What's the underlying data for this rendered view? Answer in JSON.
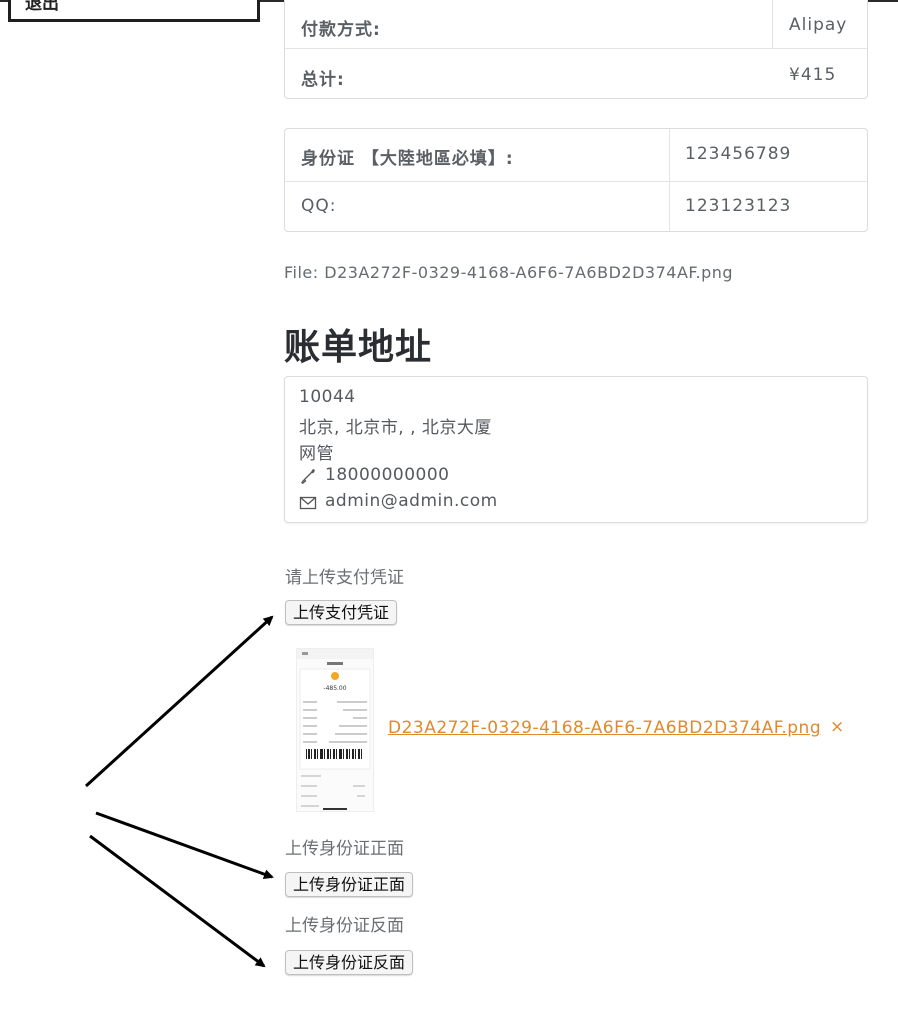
{
  "header": {
    "logout_label": "退出"
  },
  "order_summary": {
    "payment_method_label": "付款方式:",
    "payment_method_value": "Alipay",
    "total_label": "总计:",
    "total_value": "¥415"
  },
  "identity": {
    "id_card_label": "身份证 【大陸地區必填】:",
    "id_card_value": "123456789",
    "qq_label": "QQ:",
    "qq_value": "123123123"
  },
  "file_line": "File: D23A272F-0329-4168-A6F6-7A6BD2D374AF.png",
  "billing": {
    "title": "账单地址",
    "postcode": "10044",
    "address": "北京, 北京市, , 北京大厦",
    "name": "网管",
    "phone": "18000000000",
    "email": "admin@admin.com"
  },
  "uploads": {
    "payment_hint": "请上传支付凭证",
    "payment_button": "上传支付凭证",
    "payment_file_name": "D23A272F-0329-4168-A6F6-7A6BD2D374AF.png",
    "payment_file_remove": "×",
    "id_front_hint": "上传身份证正面",
    "id_front_button": "上传身份证正面",
    "id_back_hint": "上传身份证反面",
    "id_back_button": "上传身份证反面"
  },
  "thumbnail": {
    "amount": "-485.00",
    "accent_color": "#f5a623"
  }
}
